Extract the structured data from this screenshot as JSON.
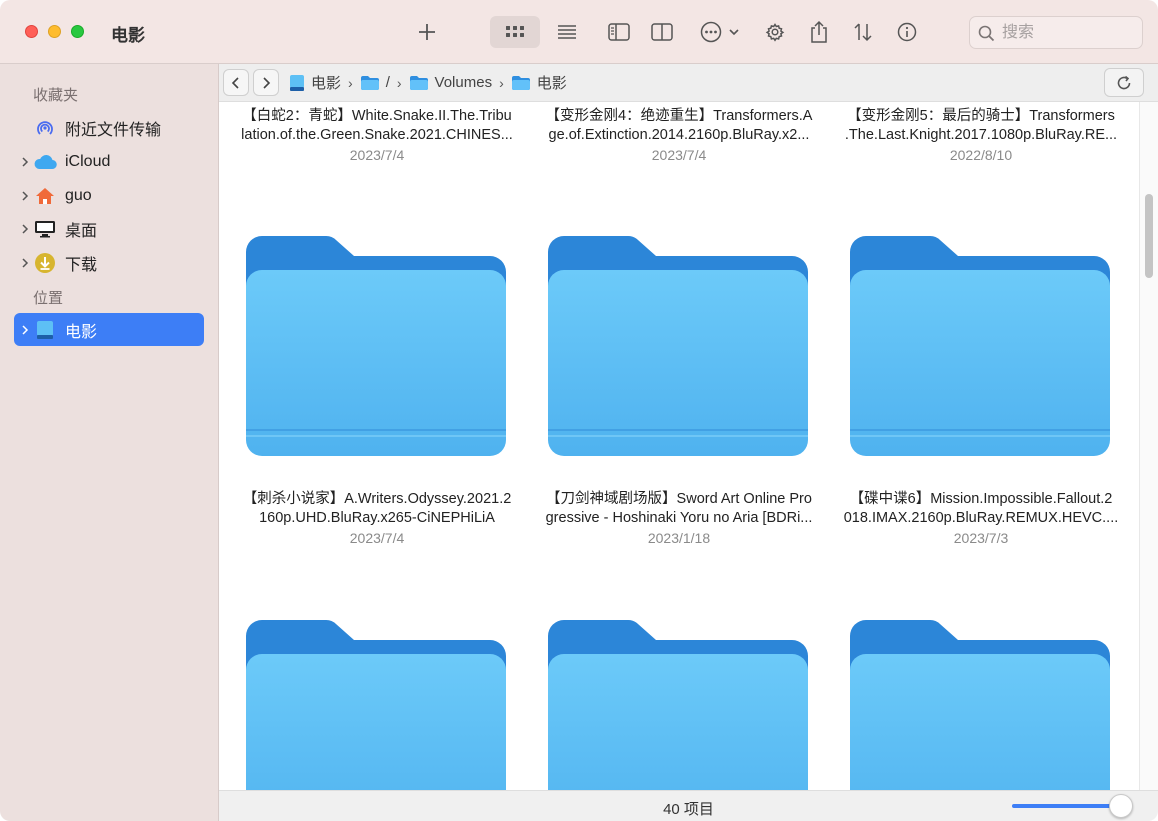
{
  "window": {
    "title": "电影"
  },
  "toolbar": {
    "search_placeholder": "搜索",
    "buttons": [
      "new-folder",
      "icon-view",
      "list-view",
      "sidebar-toggle",
      "preview-pane",
      "more-actions",
      "settings",
      "share",
      "sort",
      "info"
    ]
  },
  "sidebar": {
    "section_favorites": "收藏夹",
    "section_locations": "位置",
    "items": [
      {
        "label": "附近文件传输",
        "icon": "airdrop-icon"
      },
      {
        "label": "iCloud",
        "icon": "cloud-icon"
      },
      {
        "label": "guo",
        "icon": "home-icon"
      },
      {
        "label": "桌面",
        "icon": "desktop-icon"
      },
      {
        "label": "下载",
        "icon": "download-icon"
      },
      {
        "label": "电影",
        "icon": "drive-icon"
      }
    ]
  },
  "pathbar": {
    "crumbs": [
      "电影",
      "/",
      "Volumes",
      "电影"
    ]
  },
  "files": [
    {
      "name1": "【白蛇2：青蛇】White.Snake.II.The.Tribu",
      "name2": "lation.of.the.Green.Snake.2021.CHINES...",
      "date": "2023/7/4"
    },
    {
      "name1": "【变形金刚4：绝迹重生】Transformers.A",
      "name2": "ge.of.Extinction.2014.2160p.BluRay.x2...",
      "date": "2023/7/4"
    },
    {
      "name1": "【变形金刚5：最后的骑士】Transformers",
      "name2": ".The.Last.Knight.2017.1080p.BluRay.RE...",
      "date": "2022/8/10"
    },
    {
      "name1": "【刺杀小说家】A.Writers.Odyssey.2021.2",
      "name2": "160p.UHD.BluRay.x265-CiNEPHiLiA",
      "date": "2023/7/4"
    },
    {
      "name1": "【刀剑神域剧场版】Sword Art Online Pro",
      "name2": "gressive - Hoshinaki Yoru no Aria [BDRi...",
      "date": "2023/1/18"
    },
    {
      "name1": "【碟中谍6】Mission.Impossible.Fallout.2",
      "name2": "018.IMAX.2160p.BluRay.REMUX.HEVC....",
      "date": "2023/7/3"
    }
  ],
  "status": {
    "item_count": "40 项目",
    "zoom_level": 1.0
  },
  "colors": {
    "accent": "#3d7ef6",
    "folder_light": "#62c1f9",
    "folder_dark": "#2f8fe0"
  }
}
